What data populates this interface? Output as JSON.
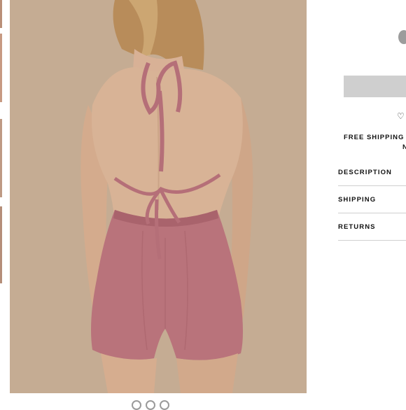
{
  "product": {
    "image_alt": "Mauve pink backless romper with braided halter ties, rear view",
    "gallery_dot_count": 3
  },
  "purchase": {
    "add_button_label": "",
    "wishlist_icon": "heart-outline-icon"
  },
  "shipping_note": {
    "line1": "FREE SHIPPING O",
    "line2": "N"
  },
  "accordion": {
    "items": [
      {
        "label": "DESCRIPTION"
      },
      {
        "label": "SHIPPING"
      },
      {
        "label": "RETURNS"
      }
    ]
  },
  "colors": {
    "photo_background": "#c5ac93",
    "romper": "#b9737b",
    "button_gray": "#cfcfcf",
    "swatch_gray": "#9c9c9c"
  }
}
